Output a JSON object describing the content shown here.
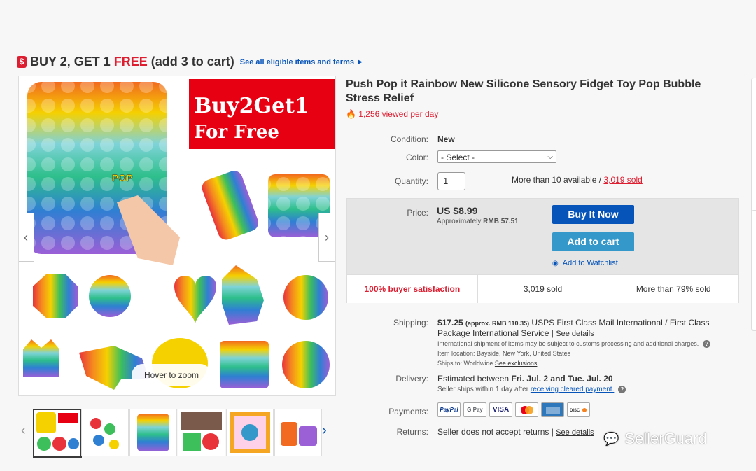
{
  "promo": {
    "tag_icon": "price-tag-icon",
    "part1": "BUY 2, GET 1",
    "part2": "FREE",
    "part3": "(add 3 to cart)",
    "link": "See all eligible items and terms"
  },
  "gallery": {
    "main_image_text_line1": "Buy2Get1",
    "main_image_text_line2": "For Free",
    "pop_text": "POP",
    "hover_hint": "Hover to zoom",
    "thumb_count": 6,
    "selected_thumb": 0
  },
  "product": {
    "title": "Push Pop it Rainbow New Silicone Sensory Fidget Toy Pop Bubble Stress Relief",
    "views": "1,256 viewed per day"
  },
  "details": {
    "condition_label": "Condition:",
    "condition_value": "New",
    "color_label": "Color:",
    "color_selected": "- Select -",
    "quantity_label": "Quantity:",
    "quantity_value": "1",
    "available": "More than 10 available /",
    "sold_link": "3,019 sold"
  },
  "price": {
    "label": "Price:",
    "value": "US $8.99",
    "approx_prefix": "Approximately",
    "approx_value": "RMB 57.51",
    "buy_now": "Buy It Now",
    "add_to_cart": "Add to cart",
    "watchlist": "Add to Watchlist"
  },
  "stats": {
    "satisfaction": "100% buyer satisfaction",
    "sold": "3,019 sold",
    "sold_percent": "More than 79% sold"
  },
  "shipping": {
    "label": "Shipping:",
    "cost": "$17.25",
    "approx": "(approx. RMB 110.35)",
    "service_line1": "USPS First Class Mail International / First Class",
    "service_line2": "Package International Service |",
    "see_details": "See details",
    "note": "International shipment of items may be subject to customs processing and additional charges.",
    "location": "Item location:  Bayside, New York, United States",
    "ships_to": "Ships to:  Worldwide",
    "see_exclusions": "See exclusions"
  },
  "delivery": {
    "label": "Delivery:",
    "estimate_prefix": "Estimated between",
    "estimate_dates": "Fri. Jul. 2 and Tue. Jul. 20",
    "seller_ships": "Seller ships within 1 day after",
    "cleared_link": "receiving cleared payment."
  },
  "payments": {
    "label": "Payments:",
    "methods": [
      "PayPal",
      "G Pay",
      "VISA",
      "Mastercard",
      "AMEX",
      "DISCOVER"
    ]
  },
  "returns": {
    "label": "Returns:",
    "text": "Seller does not accept returns |",
    "see_details": "See details"
  },
  "watermark": {
    "text": "SellerGuard"
  },
  "colors": {
    "ebay_blue": "#0654ba",
    "cart_blue": "#3498ca",
    "ebay_red": "#dd1e31"
  }
}
